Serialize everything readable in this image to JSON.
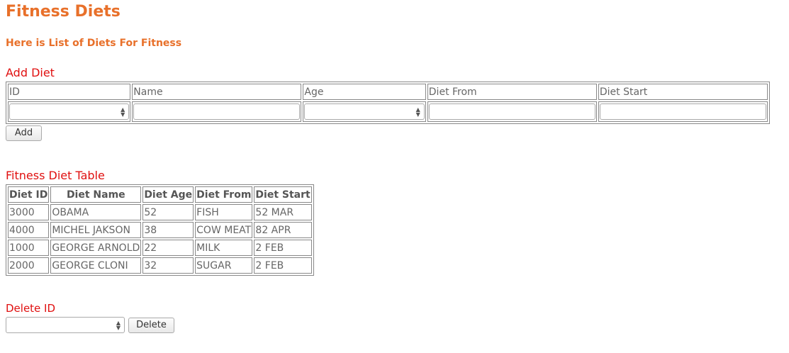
{
  "page": {
    "title": "Fitness Diets",
    "subtitle": "Here is List of Diets For Fitness"
  },
  "add_form": {
    "label": "Add Diet",
    "headers": [
      "ID",
      "Name",
      "Age",
      "Diet From",
      "Diet Start"
    ],
    "values": [
      "",
      "",
      "",
      "",
      ""
    ],
    "add_button": "Add"
  },
  "diet_table": {
    "label": "Fitness Diet Table",
    "headers": [
      "Diet ID",
      "Diet Name",
      "Diet Age",
      "Diet From",
      "Diet Start"
    ],
    "rows": [
      [
        "3000",
        "OBAMA",
        "52",
        "FISH",
        "52 MAR"
      ],
      [
        "4000",
        "MICHEL JAKSON",
        "38",
        "COW MEAT",
        "82 APR"
      ],
      [
        "1000",
        "GEORGE ARNOLD",
        "22",
        "MILK",
        "2 FEB"
      ],
      [
        "2000",
        "GEORGE CLONI",
        "32",
        "SUGAR",
        "2 FEB"
      ]
    ]
  },
  "delete_form": {
    "label": "Delete ID",
    "value": "",
    "delete_button": "Delete"
  },
  "icons": {
    "spinner": "spin-up-down-icon"
  },
  "colors": {
    "title": "#e8702a",
    "section_label": "#e01010"
  }
}
